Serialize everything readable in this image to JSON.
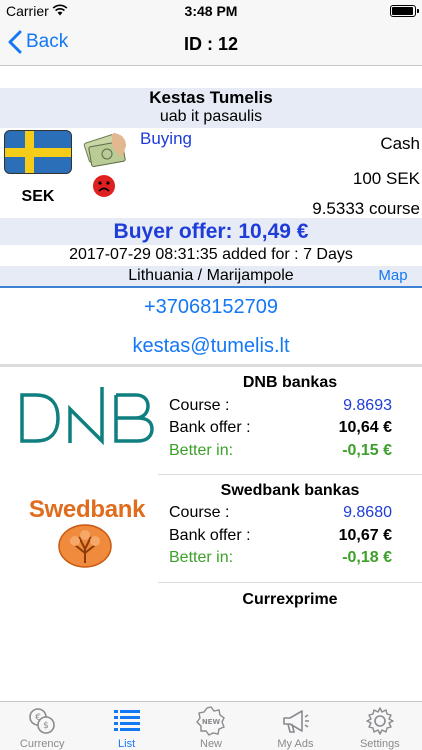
{
  "status_bar": {
    "carrier": "Carrier",
    "time": "3:48 PM"
  },
  "nav": {
    "back_label": "Back",
    "title": "ID : 12"
  },
  "ad": {
    "name": "Kestas Tumelis",
    "company": "uab it pasaulis",
    "currency_code": "SEK",
    "type": "Buying",
    "payment": "Cash",
    "amount": "100 SEK",
    "course": "9.5333 course",
    "offer": "Buyer offer: 10,49 €",
    "added": "2017-07-29 08:31:35 added for : 7 Days",
    "location": "Lithuania / Marijampole",
    "map_label": "Map",
    "phone": "+37068152709",
    "email": "kestas@tumelis.lt"
  },
  "banks": [
    {
      "name": "DNB bankas",
      "logo_text": "DNB",
      "course_label": "Course :",
      "course": "9.8693",
      "offer_label": "Bank offer :",
      "offer": "10,64 €",
      "better_label": "Better in:",
      "better": "-0,15 €"
    },
    {
      "name": "Swedbank bankas",
      "logo_text": "Swedbank",
      "course_label": "Course :",
      "course": "9.8680",
      "offer_label": "Bank offer :",
      "offer": "10,67 €",
      "better_label": "Better in:",
      "better": "-0,18 €"
    },
    {
      "name": "Currexprime"
    }
  ],
  "tabs": [
    {
      "label": "Currency",
      "icon": "currency-exchange-icon"
    },
    {
      "label": "List",
      "icon": "list-icon",
      "active": true
    },
    {
      "label": "New",
      "icon": "new-badge-icon"
    },
    {
      "label": "My Ads",
      "icon": "megaphone-icon"
    },
    {
      "label": "Settings",
      "icon": "gear-icon"
    }
  ],
  "colors": {
    "accent": "#1478f5",
    "offer_blue": "#1e3cd8",
    "better_green": "#3ca02a",
    "highlight_bg": "#e6ebf5",
    "swedbank_orange": "#e06d1e",
    "dnb_teal": "#0f7f80"
  }
}
